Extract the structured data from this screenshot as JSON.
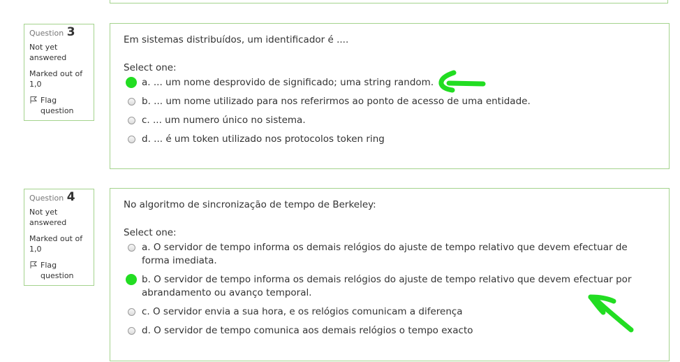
{
  "questions": [
    {
      "info": {
        "label": "Question",
        "number": "3",
        "state": "Not yet answered",
        "grade": "Marked out of 1,0",
        "flag_label": "Flag question"
      },
      "text": "Em sistemas distribuídos, um identificador é ....",
      "prompt": "Select one:",
      "options": [
        {
          "letter": "a.",
          "text": "... um nome desprovido de significado; uma string random.",
          "marked": true
        },
        {
          "letter": "b.",
          "text": "... um nome utilizado para nos referirmos ao ponto de acesso de uma entidade.",
          "marked": false
        },
        {
          "letter": "c.",
          "text": "... um numero único no sistema.",
          "marked": false
        },
        {
          "letter": "d.",
          "text": "... é um token utilizado nos protocolos token ring",
          "marked": false
        }
      ]
    },
    {
      "info": {
        "label": "Question",
        "number": "4",
        "state": "Not yet answered",
        "grade": "Marked out of 1,0",
        "flag_label": "Flag question"
      },
      "text": "No algoritmo de sincronização de tempo de Berkeley:",
      "prompt": "Select one:",
      "options": [
        {
          "letter": "a.",
          "text": "O servidor de tempo informa os demais relógios do ajuste de tempo relativo que devem efectuar de forma imediata.",
          "marked": false
        },
        {
          "letter": "b.",
          "text": "O servidor de tempo informa os demais relógios do ajuste de tempo relativo que devem efectuar por abrandamento ou avanço temporal.",
          "marked": true
        },
        {
          "letter": "c.",
          "text": "O servidor envia a sua hora, e os relógios comunicam a diferença",
          "marked": false
        },
        {
          "letter": "d.",
          "text": "O servidor de tempo comunica aos demais relógios o tempo exacto",
          "marked": false
        }
      ]
    }
  ],
  "annotation_color": "#22dd22",
  "icons": {
    "flag": "flag-icon",
    "radio": "radio-button",
    "arrow": "arrow-annotation"
  }
}
